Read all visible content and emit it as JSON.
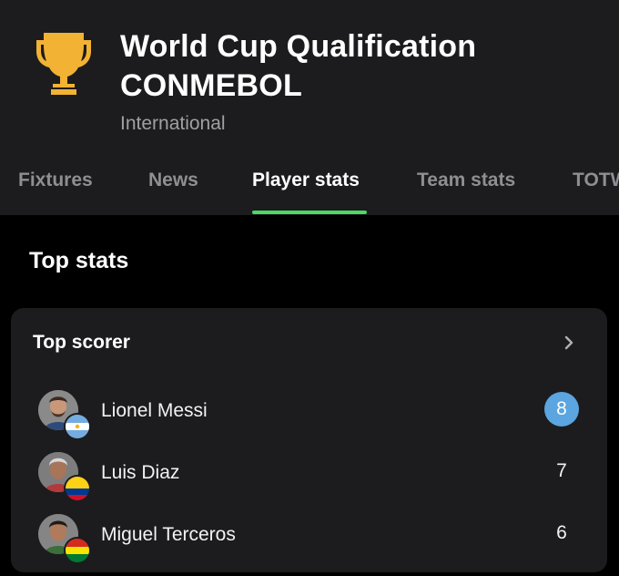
{
  "header": {
    "title_line1": "World Cup Qualification",
    "title_line2": "CONMEBOL",
    "subtitle": "International",
    "trophy_color": "#f2b233"
  },
  "tabs": [
    {
      "label": "Fixtures",
      "active": false
    },
    {
      "label": "News",
      "active": false
    },
    {
      "label": "Player stats",
      "active": true
    },
    {
      "label": "Team stats",
      "active": false
    },
    {
      "label": "TOTW",
      "active": false
    }
  ],
  "accent_color": "#4cd964",
  "section_title": "Top stats",
  "top_scorer": {
    "title": "Top scorer",
    "players": [
      {
        "name": "Lionel Messi",
        "value": "8",
        "flag": "argentina",
        "highlighted": true
      },
      {
        "name": "Luis Diaz",
        "value": "7",
        "flag": "colombia",
        "highlighted": false
      },
      {
        "name": "Miguel Terceros",
        "value": "6",
        "flag": "bolivia",
        "highlighted": false
      }
    ],
    "highlight_color": "#5ba5e0"
  }
}
